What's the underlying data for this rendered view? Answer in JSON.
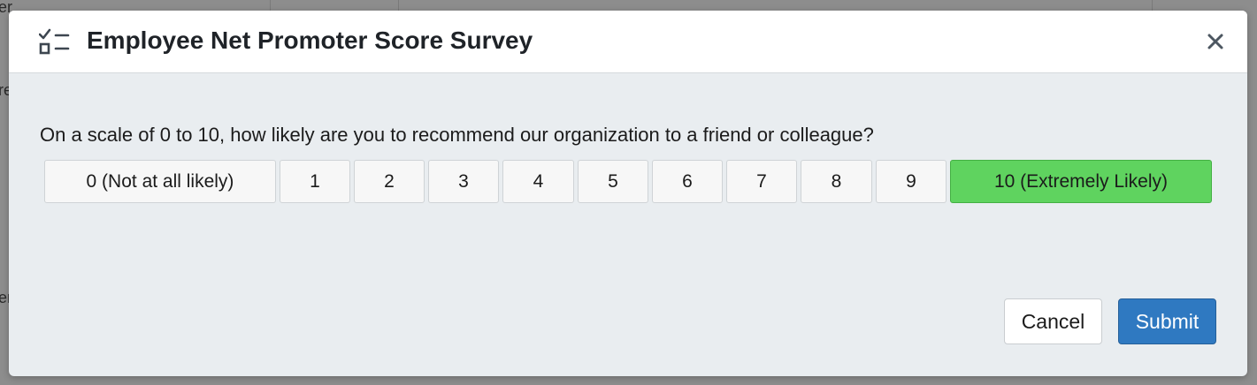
{
  "background": {
    "fragment_top": "er",
    "fragment_mid": "re",
    "fragment_low": "er"
  },
  "dialog": {
    "title": "Employee Net Promoter Score Survey",
    "title_icon": "checklist-icon",
    "close_icon": "close-icon",
    "question": "On a scale of 0 to 10, how likely are you to recommend our organization to a friend or colleague?",
    "options": [
      {
        "label": "0 (Not at all likely)",
        "selected": false
      },
      {
        "label": "1",
        "selected": false
      },
      {
        "label": "2",
        "selected": false
      },
      {
        "label": "3",
        "selected": false
      },
      {
        "label": "4",
        "selected": false
      },
      {
        "label": "5",
        "selected": false
      },
      {
        "label": "6",
        "selected": false
      },
      {
        "label": "7",
        "selected": false
      },
      {
        "label": "8",
        "selected": false
      },
      {
        "label": "9",
        "selected": false
      },
      {
        "label": "10 (Extremely Likely)",
        "selected": true
      }
    ],
    "cancel_label": "Cancel",
    "submit_label": "Submit"
  },
  "colors": {
    "selected_option": "#5fd35f",
    "primary_button": "#2f79c1"
  }
}
